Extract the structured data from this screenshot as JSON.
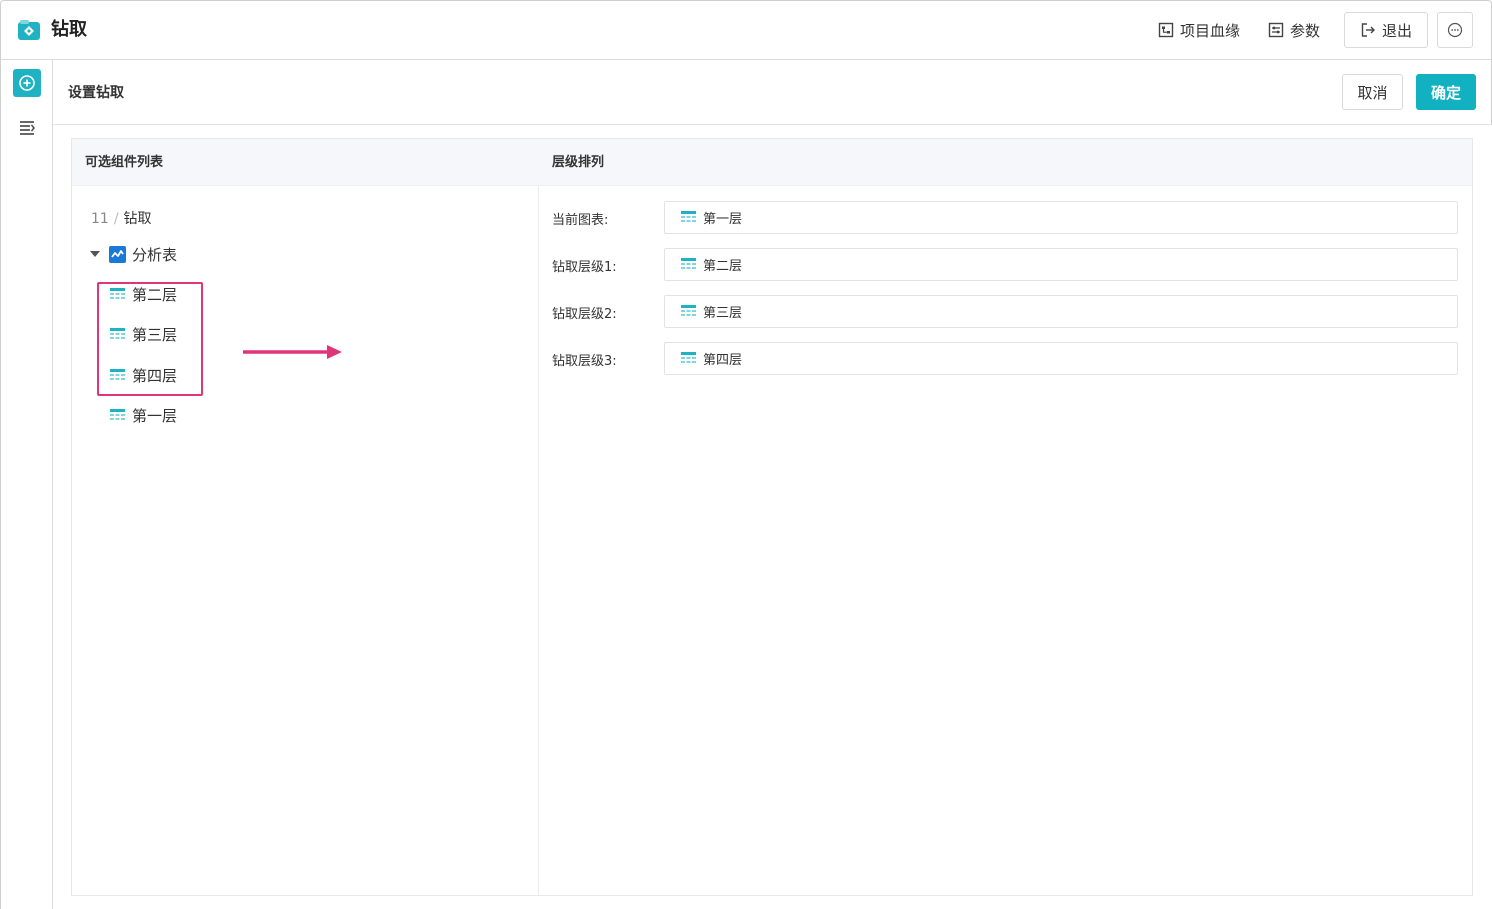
{
  "app": {
    "title": "钻取"
  },
  "toolbar": {
    "lineage_label": "项目血缘",
    "params_label": "参数",
    "exit_label": "退出"
  },
  "panel": {
    "title": "设置钻取",
    "cancel_label": "取消",
    "confirm_label": "确定"
  },
  "left_column": {
    "header": "可选组件列表",
    "breadcrumb": {
      "parent": "11",
      "separator": "/",
      "current": "钻取"
    },
    "tree_root": {
      "label": "分析表",
      "expanded": true
    },
    "tree_children": [
      {
        "label": "第二层",
        "highlighted": true
      },
      {
        "label": "第三层",
        "highlighted": true
      },
      {
        "label": "第四层",
        "highlighted": true
      },
      {
        "label": "第一层",
        "highlighted": false
      }
    ]
  },
  "right_column": {
    "header": "层级排列",
    "levels": [
      {
        "label": "当前图表:",
        "value": "第一层"
      },
      {
        "label": "钻取层级1:",
        "value": "第二层"
      },
      {
        "label": "钻取层级2:",
        "value": "第三层"
      },
      {
        "label": "钻取层级3:",
        "value": "第四层"
      }
    ]
  },
  "colors": {
    "accent": "#12b1c1",
    "highlight": "#e0357a",
    "chart_icon": "#1a79d6"
  },
  "icons": [
    "app-logo-icon",
    "lineage-icon",
    "params-icon",
    "exit-icon",
    "more-icon",
    "add-circle-icon",
    "list-icon",
    "caret-down-icon",
    "line-chart-icon",
    "table-icon",
    "right-arrow-annotation"
  ]
}
